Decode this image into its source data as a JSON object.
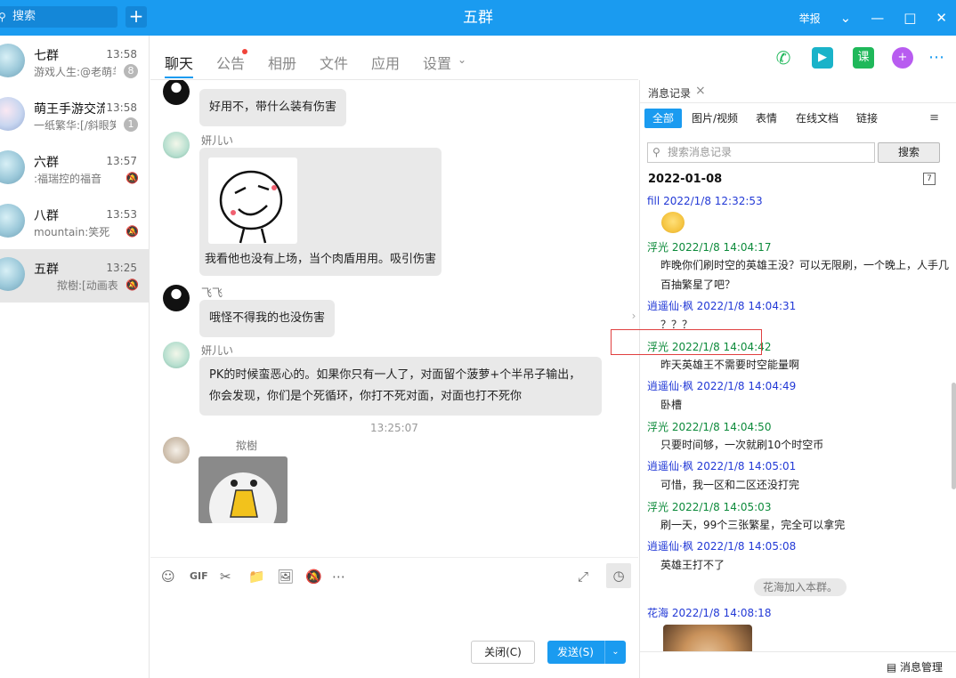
{
  "window": {
    "title": "五群",
    "report": "举报"
  },
  "search": {
    "placeholder": "搜索"
  },
  "conversations": [
    {
      "name": "七群",
      "time": "13:58",
      "preview": "游戏人生:@老萌羊",
      "badge": "8"
    },
    {
      "name": "萌王手游交流",
      "time": "13:58",
      "preview": "一纸繁华:[/斜眼笑]",
      "badge": "1"
    },
    {
      "name": "六群",
      "time": "13:57",
      "preview": ":福瑞控的福音",
      "badge": ""
    },
    {
      "name": "八群",
      "time": "13:53",
      "preview": "mountain:笑死",
      "badge": ""
    },
    {
      "name": "五群",
      "time": "13:25",
      "preview": "揿樹:[动画表情]",
      "badge": ""
    }
  ],
  "chat_tabs": [
    "聊天",
    "公告",
    "相册",
    "文件",
    "应用",
    "设置"
  ],
  "messages": [
    {
      "sender": "飞飞",
      "text": "好用不，带什么装有伤害"
    },
    {
      "sender": "妍儿い",
      "text": "我看他也没有上场，当个肉盾用用。吸引伤害"
    },
    {
      "sender": "飞飞",
      "text": "哦怪不得我的也没伤害"
    },
    {
      "sender": "妍儿い",
      "text": "PK的时候蛮恶心的。如果你只有一人了，对面留个菠萝+个半吊子输出，你会发现，你们是个死循环，你打不死对面，对面也打不死你"
    },
    {
      "sender": "揿樹",
      "text": ""
    }
  ],
  "chat_time": "13:25:07",
  "buttons": {
    "close": "关闭(C)",
    "send": "发送(S)"
  },
  "history": {
    "title": "消息记录",
    "filters": [
      "全部",
      "图片/视频",
      "表情",
      "在线文档",
      "链接"
    ],
    "search_placeholder": "搜索消息记录",
    "search_btn": "搜索",
    "date": "2022-01-08",
    "entries": [
      {
        "sender": "fill",
        "time": "2022/1/8 12:32:53",
        "text": ""
      },
      {
        "sender": "浮光",
        "time": "2022/1/8 14:04:17",
        "text": "昨晚你们刷时空的英雄王没？可以无限刷，一个晚上，人手几",
        "text2": "百抽繁星了吧？"
      },
      {
        "sender": "逍遥仙·枫",
        "time": "2022/1/8 14:04:31",
        "text": "？？？"
      },
      {
        "sender": "浮光",
        "time": "2022/1/8 14:04:42",
        "text": "昨天英雄王不需要时空能量啊"
      },
      {
        "sender": "逍遥仙·枫",
        "time": "2022/1/8 14:04:49",
        "text": "卧槽"
      },
      {
        "sender": "浮光",
        "time": "2022/1/8 14:04:50",
        "text": "只要时间够，一次就刷10个时空币"
      },
      {
        "sender": "逍遥仙·枫",
        "time": "2022/1/8 14:05:01",
        "text": "可惜，我一区和二区还没打完"
      },
      {
        "sender": "浮光",
        "time": "2022/1/8 14:05:03",
        "text": "刷一天，99个三张繁星，完全可以拿完"
      },
      {
        "sender": "逍遥仙·枫",
        "time": "2022/1/8 14:05:08",
        "text": "英雄王打不了"
      },
      {
        "sender": "花海",
        "time": "2022/1/8 14:08:18",
        "text": ""
      }
    ],
    "notice": "花海加入本群。",
    "manage": "消息管理"
  },
  "colors": {
    "accent": "#1a9bf0",
    "name_blue": "#2239d6",
    "name_green": "#0c8a3a",
    "highlight": "#e04040"
  }
}
